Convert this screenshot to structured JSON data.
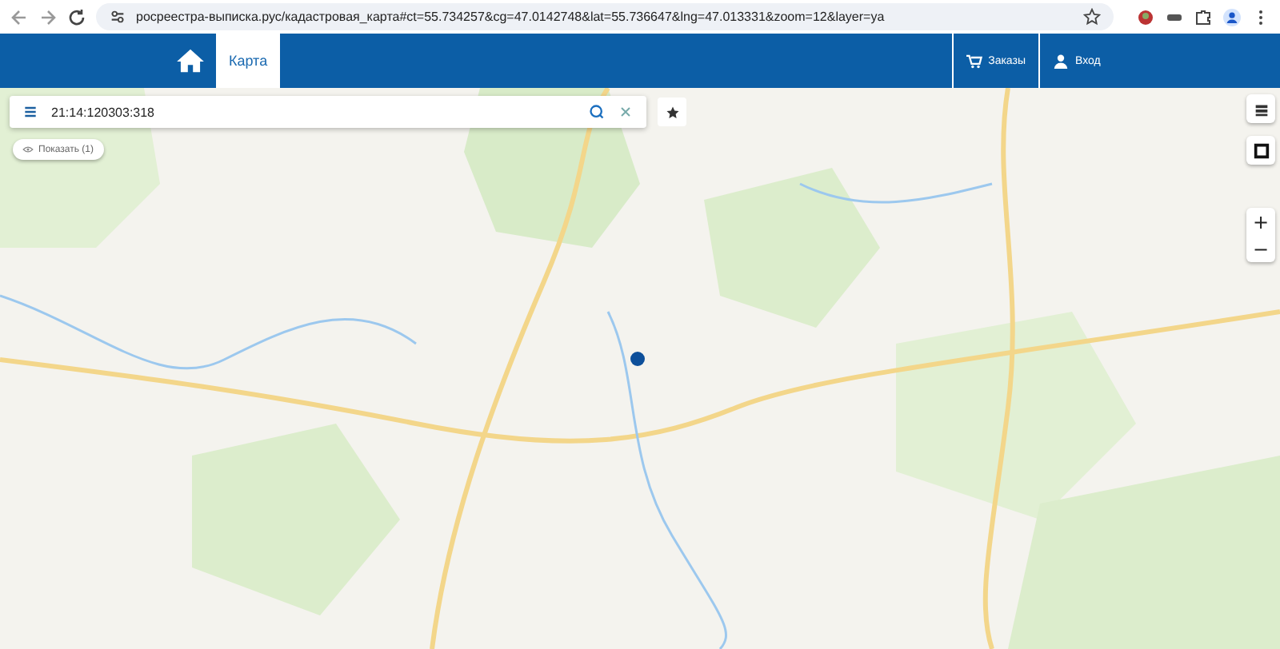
{
  "browser": {
    "url": "росреестра-выписка.рус/кадастровая_карта#ct=55.734257&cg=47.0142748&lat=55.736647&lng=47.013331&zoom=12&layer=ya"
  },
  "header": {
    "tabs": [
      {
        "label": "Карта",
        "selected": true
      }
    ],
    "actions": [
      "Заказы",
      "Вход"
    ]
  },
  "search": {
    "value": "21:14:120303:318"
  },
  "show_button": "Показать (1)",
  "zoom": {
    "in": "+",
    "out": "−"
  }
}
